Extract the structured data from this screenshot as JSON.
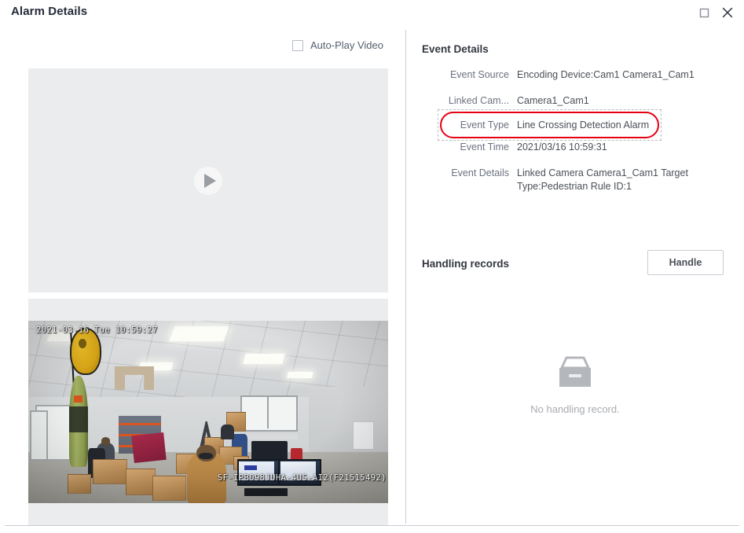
{
  "window": {
    "title": "Alarm Details",
    "controls": [
      {
        "name": "maximize-button",
        "icon": "maximize-icon"
      },
      {
        "name": "close-button",
        "icon": "close-icon"
      }
    ]
  },
  "left_panel": {
    "autoplay": {
      "label": "Auto-Play Video",
      "checked": false
    },
    "video": {
      "play_icon": "play-icon",
      "state": "paused"
    },
    "snapshot": {
      "timestamp_osd": "2021-03-16 Tue 10:59:27",
      "model_osd": "SF-IPB098JUHA-4US-AI2(F21515492)",
      "description": "Office interior CCTV snapshot"
    }
  },
  "right_panel": {
    "event_details_title": "Event Details",
    "rows": [
      {
        "label": "Event Source",
        "value": "Encoding Device:Cam1 Camera1_Cam1",
        "highlighted": false
      },
      {
        "label": "Linked Cam...",
        "value": "Camera1_Cam1",
        "highlighted": false
      },
      {
        "label": "Event Type",
        "value": "Line Crossing Detection Alarm",
        "highlighted": true
      },
      {
        "label": "Event Time",
        "value": "2021/03/16 10:59:31",
        "highlighted": false
      },
      {
        "label": "Event Details",
        "value": "Linked Camera Camera1_Cam1 Target Type:Pedestrian Rule ID:1",
        "highlighted": false
      }
    ],
    "handling": {
      "title": "Handling records",
      "button_label": "Handle",
      "empty_text": "No handling record.",
      "empty_icon": "empty-box-icon"
    }
  },
  "colors": {
    "highlight_red": "#e60012",
    "title_text": "#252b3a",
    "label_text": "#6b7280",
    "value_text": "#4a4f57",
    "divider": "#c8ccd4",
    "panel_bg": "#ebecee"
  }
}
